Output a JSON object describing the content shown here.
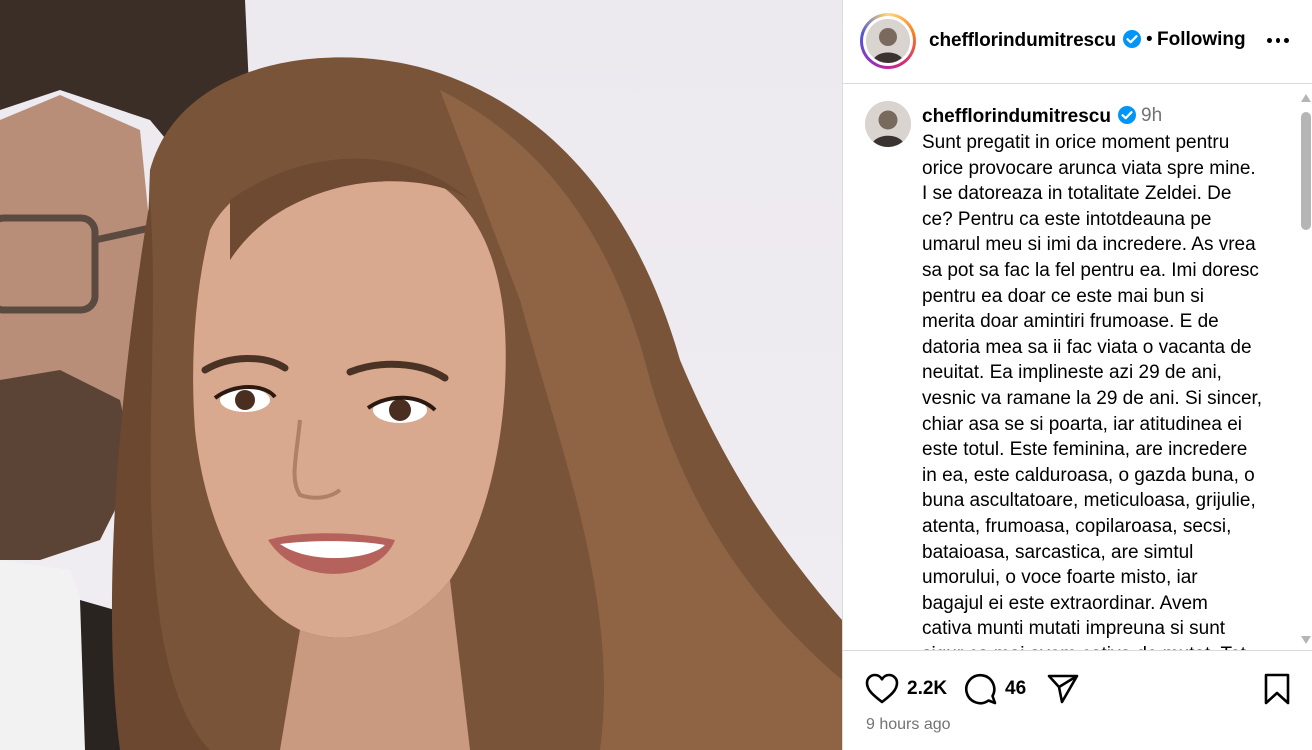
{
  "post": {
    "username": "chefflorindumitrescu",
    "follow_status": "Following",
    "more_label": "•••",
    "separator": "•"
  },
  "caption": {
    "username": "chefflorindumitrescu",
    "time": "9h",
    "text": "Sunt pregatit in orice moment pentru\norice provocare arunca viata spre mine.\nI se datoreaza in totalitate Zeldei. De\nce? Pentru ca este intotdeauna pe\numarul meu si imi da incredere. As vrea\nsa pot sa fac la fel pentru ea. Imi doresc\npentru ea doar ce este mai bun si\nmerita doar amintiri frumoase. E de\ndatoria mea sa ii fac viata o vacanta de\nneuitat. Ea implineste azi 29 de ani,\nvesnic va ramane la 29 de ani. Si sincer,\nchiar asa se si poarta, iar atitudinea ei\neste totul. Este feminina, are incredere\nin ea, este calduroasa, o gazda buna, o\nbuna ascultatoare, meticuloasa, grijulie,\natenta, frumoasa, copilaroasa, secsi,\nbataioasa, sarcastica, are simtul\numorului, o voce foarte misto, iar\nbagajul ei este extraordinar. Avem\ncativa munti mutati impreuna si sunt\nsigur ca mai avem cativa de mutat. Tot"
  },
  "actions": {
    "likes": "2.2K",
    "comments": "46",
    "time_ago": "9 hours ago"
  },
  "icons": {
    "like": "heart-icon",
    "comment": "comment-icon",
    "share": "share-icon",
    "save": "bookmark-icon",
    "verified": "verified-badge-icon"
  },
  "colors": {
    "verified_blue": "#0095f6",
    "secondary_text": "#737373",
    "divider": "#dbdbdb"
  }
}
